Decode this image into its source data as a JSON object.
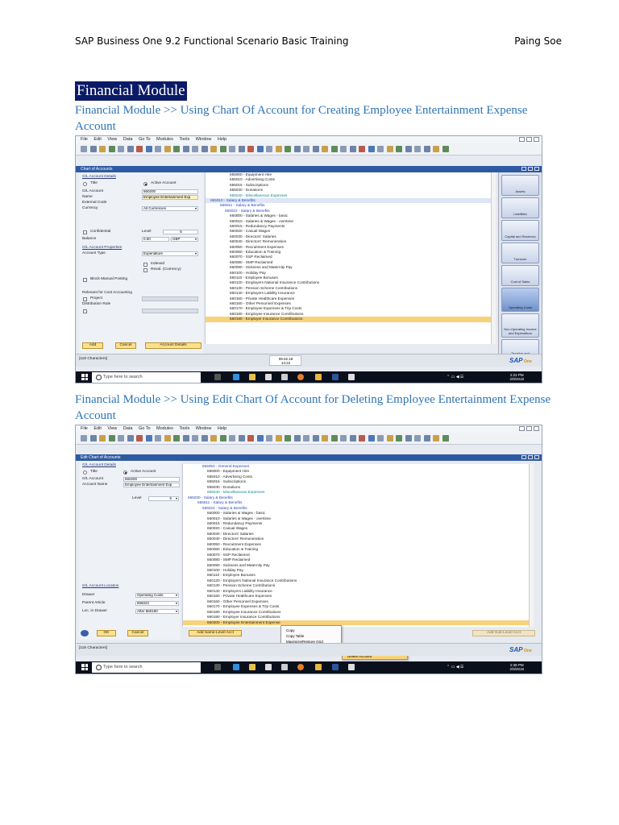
{
  "header": {
    "left": "SAP Business One 9.2 Functional Scenario Basic Training",
    "right": "Paing Soe"
  },
  "module_title": "Financial Module",
  "section1": {
    "heading": "Financial Module >> Using Chart Of Account for Creating Employee Entertainment Expense Account",
    "menu": [
      "File",
      "Edit",
      "View",
      "Data",
      "Go To",
      "Modules",
      "Tools",
      "Window",
      "Help"
    ],
    "window_title": "Chart of Accounts",
    "form": {
      "gl_details": "G/L Account Details",
      "title_radio": "Title",
      "active_radio": "Active Account",
      "gl_account_label": "G/L Account",
      "gl_account_value": "660200",
      "name_label": "Name",
      "name_value": "Employee Entertainment Exp",
      "external_code_label": "External Code",
      "currency_label": "Currency",
      "currency_value": "All Currencies",
      "confidential_label": "Confidential",
      "level_label": "Level",
      "level_value": "5",
      "balance_label": "Balance",
      "balance_value": "0.00",
      "balance_currency": "GBP",
      "properties_label": "G/L Account Properties",
      "account_type_label": "Account Type",
      "account_type_value": "Expenditure",
      "indexed_label": "Indexed",
      "reval_label": "Reval. (Currency)",
      "block_label": "Block Manual Posting",
      "relevant_label": "Relevant for Cost Accounting",
      "project_label": "Project",
      "distribution_label": "Distribution Rule",
      "add_button": "Add",
      "cancel_button": "Cancel",
      "account_details_button": "Account Details"
    },
    "tree": [
      {
        "text": "655000 - Equipment Hire",
        "indent": 2,
        "style": ""
      },
      {
        "text": "655010 - Advertising Costs",
        "indent": 2,
        "style": ""
      },
      {
        "text": "655015 - Subscriptions",
        "indent": 2,
        "style": ""
      },
      {
        "text": "655030 - Donations",
        "indent": 2,
        "style": ""
      },
      {
        "text": "655040 - Miscellaneous Expenses",
        "indent": 2,
        "style": "teal"
      },
      {
        "text": "655010 - Salary & Benefits",
        "indent": 0,
        "style": "hdr"
      },
      {
        "text": "655011 - Salary & Benefits",
        "indent": 1,
        "style": "grp"
      },
      {
        "text": "655022 - Salary & Benefits",
        "indent": 1.5,
        "style": "grp"
      },
      {
        "text": "660000 - Salaries & Wages - basic",
        "indent": 2,
        "style": ""
      },
      {
        "text": "660010 - Salaries & Wages - overtime",
        "indent": 2,
        "style": ""
      },
      {
        "text": "660015 - Redundancy Payments",
        "indent": 2,
        "style": ""
      },
      {
        "text": "660020 - Casual Wages",
        "indent": 2,
        "style": ""
      },
      {
        "text": "660030 - Directors' Salaries",
        "indent": 2,
        "style": ""
      },
      {
        "text": "660040 - Directors' Remuneration",
        "indent": 2,
        "style": ""
      },
      {
        "text": "660050 - Recruitment Expenses",
        "indent": 2,
        "style": ""
      },
      {
        "text": "660060 - Education & Training",
        "indent": 2,
        "style": ""
      },
      {
        "text": "660070 - SSP Reclaimed",
        "indent": 2,
        "style": ""
      },
      {
        "text": "660080 - SMP Reclaimed",
        "indent": 2,
        "style": ""
      },
      {
        "text": "660090 - Sickness and Maternity Pay",
        "indent": 2,
        "style": ""
      },
      {
        "text": "660100 - Holiday Pay",
        "indent": 2,
        "style": ""
      },
      {
        "text": "660110 - Employee Bonuses",
        "indent": 2,
        "style": ""
      },
      {
        "text": "660120 - Employers National Insurance Contributions",
        "indent": 2,
        "style": ""
      },
      {
        "text": "660130 - Pension Scheme Contributions",
        "indent": 2,
        "style": ""
      },
      {
        "text": "660140 - Employers Liability Insurance",
        "indent": 2,
        "style": ""
      },
      {
        "text": "660150 - Private Healthcare Expenses",
        "indent": 2,
        "style": ""
      },
      {
        "text": "660160 - Other Personnel Expenses",
        "indent": 2,
        "style": ""
      },
      {
        "text": "660170 - Employee Expenses & Trip Costs",
        "indent": 2,
        "style": ""
      },
      {
        "text": "660180 - Employee Insurance Contributions",
        "indent": 2,
        "style": ""
      },
      {
        "text": "660190 - Employer Insurance Contributions",
        "indent": 2,
        "style": "sel"
      }
    ],
    "drawers": [
      "Assets",
      "Liabilities",
      "Capital and Reserves",
      "Turnover",
      "Cost of Sales",
      "Operating Costs",
      "Non-Operating Income and Expenditure",
      "Taxation and Extraordinary Items"
    ],
    "status": "[118 Characters]",
    "status_date": "09.02.18",
    "status_time": "14:22",
    "taskbar_search": "Type here to search",
    "clock_time": "2:22 PM",
    "clock_date": "2/9/2018"
  },
  "section2": {
    "heading": "Financial Module >> Using Edit Chart Of Account for Deleting Employee Entertainment Expense Account",
    "window_title": "Edit Chart of Accounts",
    "form": {
      "gl_details": "G/L Account Details",
      "title_radio": "Title",
      "active_radio": "Active Account",
      "gl_account_label": "G/L Account",
      "gl_account_value": "660200",
      "name_label": "Account Name",
      "name_value": "Employee Entertainment Exp",
      "level_label": "Level",
      "level_value": "5",
      "location_label": "G/L Account Location",
      "drawer_label": "Drawer",
      "drawer_value": "Operating Costs",
      "parent_label": "Parent Article",
      "parent_value": "655022",
      "loc_label": "Loc. in Drawer",
      "loc_value": "After 660190",
      "ok_button": "OK",
      "cancel_button": "Cancel",
      "add_same_button": "Add Same-Level Acct",
      "add_sub_button": "Add Sub-Level Acct"
    },
    "tree": [
      {
        "text": "655053 - General Expenses",
        "indent": 1.5,
        "style": "grp"
      },
      {
        "text": "655000 - Equipment Hire",
        "indent": 2,
        "style": ""
      },
      {
        "text": "655010 - Advertising Costs",
        "indent": 2,
        "style": ""
      },
      {
        "text": "655015 - Subscriptions",
        "indent": 2,
        "style": ""
      },
      {
        "text": "655030 - Donations",
        "indent": 2,
        "style": ""
      },
      {
        "text": "655040 - Miscellaneous Expenses",
        "indent": 2,
        "style": "teal"
      },
      {
        "text": "655030 - Salary & Benefits",
        "indent": 0,
        "style": "grp"
      },
      {
        "text": "655511 - Salary & Benefits",
        "indent": 1,
        "style": "grp"
      },
      {
        "text": "655022 - Salary & Benefits",
        "indent": 1.5,
        "style": "grp"
      },
      {
        "text": "660000 - Salaries & Wages - basic",
        "indent": 2,
        "style": ""
      },
      {
        "text": "660010 - Salaries & Wages - overtime",
        "indent": 2,
        "style": ""
      },
      {
        "text": "660015 - Redundancy Payments",
        "indent": 2,
        "style": ""
      },
      {
        "text": "660020 - Casual Wages",
        "indent": 2,
        "style": ""
      },
      {
        "text": "660030 - Directors' Salaries",
        "indent": 2,
        "style": ""
      },
      {
        "text": "660040 - Directors' Remuneration",
        "indent": 2,
        "style": ""
      },
      {
        "text": "660050 - Recruitment Expenses",
        "indent": 2,
        "style": ""
      },
      {
        "text": "660060 - Education & Training",
        "indent": 2,
        "style": ""
      },
      {
        "text": "660070 - SSP Reclaimed",
        "indent": 2,
        "style": ""
      },
      {
        "text": "660080 - SMP Reclaimed",
        "indent": 2,
        "style": ""
      },
      {
        "text": "660090 - Sickness and Maternity Pay",
        "indent": 2,
        "style": ""
      },
      {
        "text": "660100 - Holiday Pay",
        "indent": 2,
        "style": ""
      },
      {
        "text": "660110 - Employee Bonuses",
        "indent": 2,
        "style": ""
      },
      {
        "text": "660120 - Employers National Insurance Contributions",
        "indent": 2,
        "style": ""
      },
      {
        "text": "660130 - Pension Scheme Contributions",
        "indent": 2,
        "style": ""
      },
      {
        "text": "660140 - Employers Liability Insurance",
        "indent": 2,
        "style": ""
      },
      {
        "text": "660150 - Private Healthcare Expenses",
        "indent": 2,
        "style": ""
      },
      {
        "text": "660160 - Other Personnel Expenses",
        "indent": 2,
        "style": ""
      },
      {
        "text": "660170 - Employee Expenses & Trip Costs",
        "indent": 2,
        "style": ""
      },
      {
        "text": "660180 - Employee Insurance Contributions",
        "indent": 2,
        "style": ""
      },
      {
        "text": "660190 - Employer Insurance Contributions",
        "indent": 2,
        "style": ""
      },
      {
        "text": "660200 - Employee Entertainment Expense",
        "indent": 2,
        "style": "sel"
      }
    ],
    "context_menu": [
      "Copy",
      "Copy Table",
      "Maximize/Restore Grid",
      "Advanced"
    ],
    "submenu": [
      "Add Same-Level Account",
      "Delete Account"
    ],
    "status": "[118 Characters]",
    "taskbar_search": "Type here to search",
    "clock_time": "2:38 PM",
    "clock_date": "2/9/2018"
  },
  "sap_logo": {
    "sap": "SAP",
    "one": "One",
    "business": "Business"
  }
}
